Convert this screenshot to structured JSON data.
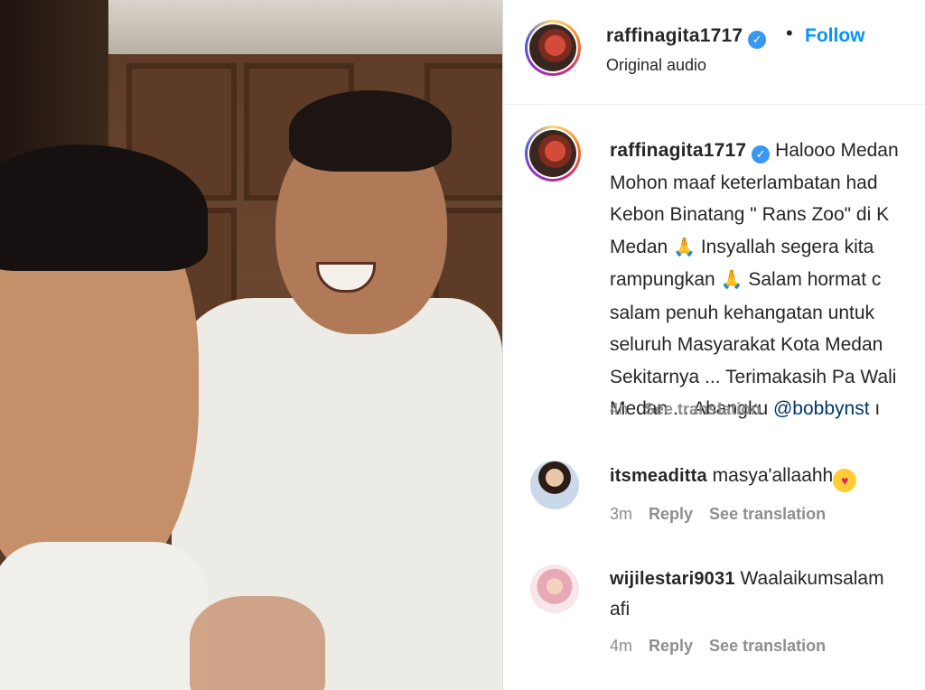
{
  "post": {
    "username": "raffinagita1717",
    "verified_glyph": "✓",
    "separator": "•",
    "follow_label": "Follow",
    "audio_label": "Original audio"
  },
  "caption": {
    "username": "raffinagita1717",
    "lines": [
      "Halooo Medan",
      "Mohon maaf keterlambatan had",
      "Kebon Binatang \" Rans Zoo\" di K",
      "Medan",
      "Insyallah segera kita",
      "rampungkan",
      "Salam hormat c",
      "salam penuh kehangatan untuk",
      "seluruh Masyarakat Kota Medan",
      "Sekitarnya ... Terimakasih Pa Wali",
      "Medan ... Abangku",
      "@bobbynst",
      "ı"
    ],
    "pray_emoji": "🙏",
    "time": "4h",
    "see_translation": "See translation"
  },
  "comments": [
    {
      "username": "itsmeaditta",
      "text": "masya'allaahh",
      "emoji": "😍",
      "time": "3m",
      "reply_label": "Reply",
      "see_translation": "See translation"
    },
    {
      "username": "wijilestari9031",
      "text": "Waalaikumsalam",
      "text_line2": "afi",
      "time": "4m",
      "reply_label": "Reply",
      "see_translation": "See translation"
    }
  ],
  "colors": {
    "follow_blue": "#0095f6",
    "verified_blue": "#3897f0",
    "mention": "#00376b",
    "muted": "#8e8e8e"
  },
  "icons": [
    "verified-badge-icon",
    "pray-emoji-icon",
    "heart-eyes-emoji-icon"
  ]
}
